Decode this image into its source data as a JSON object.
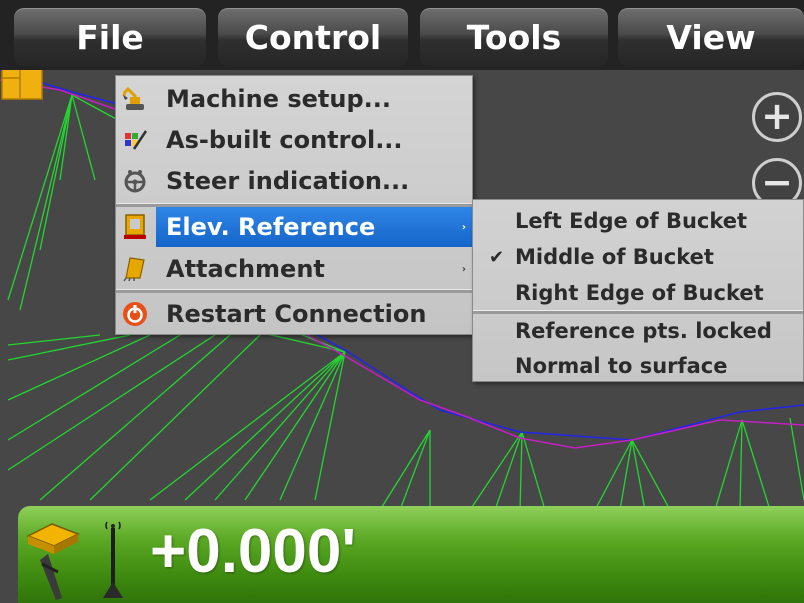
{
  "menubar": {
    "items": [
      "File",
      "Control",
      "Tools",
      "View"
    ]
  },
  "zoom": {
    "in_label": "+",
    "out_label": "−"
  },
  "control_menu": {
    "items": [
      {
        "label": "Machine setup...",
        "icon": "excavator-icon"
      },
      {
        "label": "As-built control...",
        "icon": "as-built-icon"
      },
      {
        "label": "Steer indication...",
        "icon": "steering-wheel-icon"
      },
      {
        "label": "Elev. Reference",
        "icon": "elevation-reference-icon",
        "submenu": true,
        "active": true
      },
      {
        "label": "Attachment",
        "icon": "bucket-icon",
        "submenu": true
      },
      {
        "label": "Restart Connection",
        "icon": "restart-icon"
      }
    ],
    "arrow": "›"
  },
  "elev_reference_submenu": {
    "items": [
      {
        "label": "Left Edge of Bucket",
        "checked": false
      },
      {
        "label": "Middle of Bucket",
        "checked": true
      },
      {
        "label": "Right Edge of Bucket",
        "checked": false
      },
      {
        "label": "Reference pts. locked",
        "checked": false
      },
      {
        "label": "Normal to surface",
        "checked": false
      }
    ],
    "check_mark": "✔"
  },
  "status": {
    "elevation": "+0.000'"
  },
  "colors": {
    "menu_bg": "#232323",
    "active_item": "#1f74d8",
    "status_green": "#4c9a1a",
    "design_line": "#2222ee",
    "surface_line": "#c020c0",
    "wire_green": "#22dd33",
    "bucket_yellow": "#f0b010"
  }
}
